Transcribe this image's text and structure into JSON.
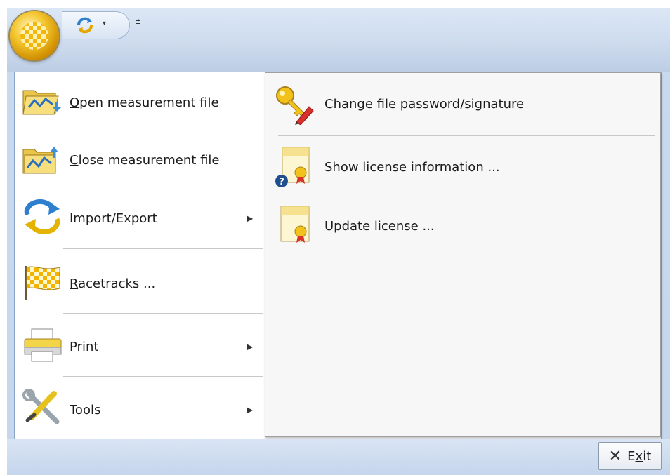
{
  "quick_access": {
    "refresh_icon": "refresh-icon",
    "dropdown_glyph": "▾",
    "customize_glyph": "⩧"
  },
  "menu_left": [
    {
      "label_prefix": "",
      "label_mnemonic": "O",
      "label_rest": "pen measurement file",
      "icon": "open-folder-chart-icon",
      "has_submenu": false
    },
    {
      "label_prefix": "",
      "label_mnemonic": "C",
      "label_rest": "lose measurement file",
      "icon": "close-folder-chart-icon",
      "has_submenu": false
    },
    {
      "label_prefix": "Import/Export",
      "label_mnemonic": "",
      "label_rest": "",
      "icon": "import-export-icon",
      "has_submenu": true
    },
    {
      "label_prefix": "",
      "label_mnemonic": "R",
      "label_rest": "acetracks ...",
      "icon": "checkered-flag-icon",
      "has_submenu": false
    },
    {
      "label_prefix": "Print",
      "label_mnemonic": "",
      "label_rest": "",
      "icon": "printer-icon",
      "has_submenu": true
    },
    {
      "label_prefix": "Tools",
      "label_mnemonic": "",
      "label_rest": "",
      "icon": "tools-icon",
      "has_submenu": true
    }
  ],
  "submenu_arrow": "▶",
  "menu_right": [
    {
      "label": "Change file password/signature",
      "icon": "key-pen-icon"
    },
    {
      "label": "Show license information ...",
      "icon": "license-info-icon"
    },
    {
      "label": "Update license ...",
      "icon": "license-icon"
    }
  ],
  "exit_button": {
    "glyph": "✕",
    "prefix": "E",
    "mnemonic": "x",
    "rest": "it"
  },
  "colors": {
    "accent": "#f2b400",
    "frame": "#c6d6ec",
    "border": "#8aa4c8"
  }
}
